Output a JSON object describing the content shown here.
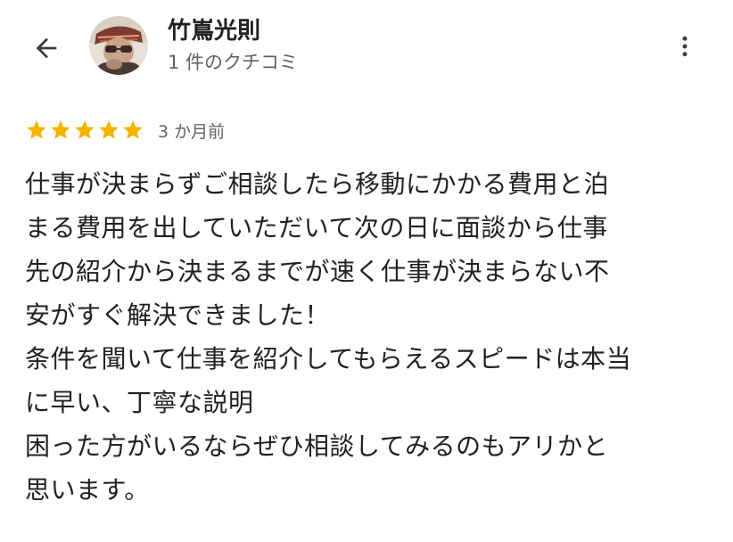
{
  "header": {
    "back_icon": "arrow-back-icon",
    "user_name": "竹嶌光則",
    "review_count": "1 件のクチコミ",
    "more_icon": "more-vert-icon"
  },
  "review": {
    "rating": 5,
    "rating_max": 5,
    "star_color": "#f4b400",
    "star_icon": "star-icon",
    "date": "3 か月前",
    "lines": [
      "仕事が決まらずご相談したら移動にかかる費用と泊",
      "まる費用を出していただいて次の日に面談から仕事",
      "先の紹介から決まるまでが速く仕事が決まらない不",
      "安がすぐ解決できました！",
      "条件を聞いて仕事を紹介してもらえるスピードは本当",
      "に早い、丁寧な説明",
      "困った方がいるならぜひ相談してみるのもアリかと",
      "思います。"
    ]
  }
}
